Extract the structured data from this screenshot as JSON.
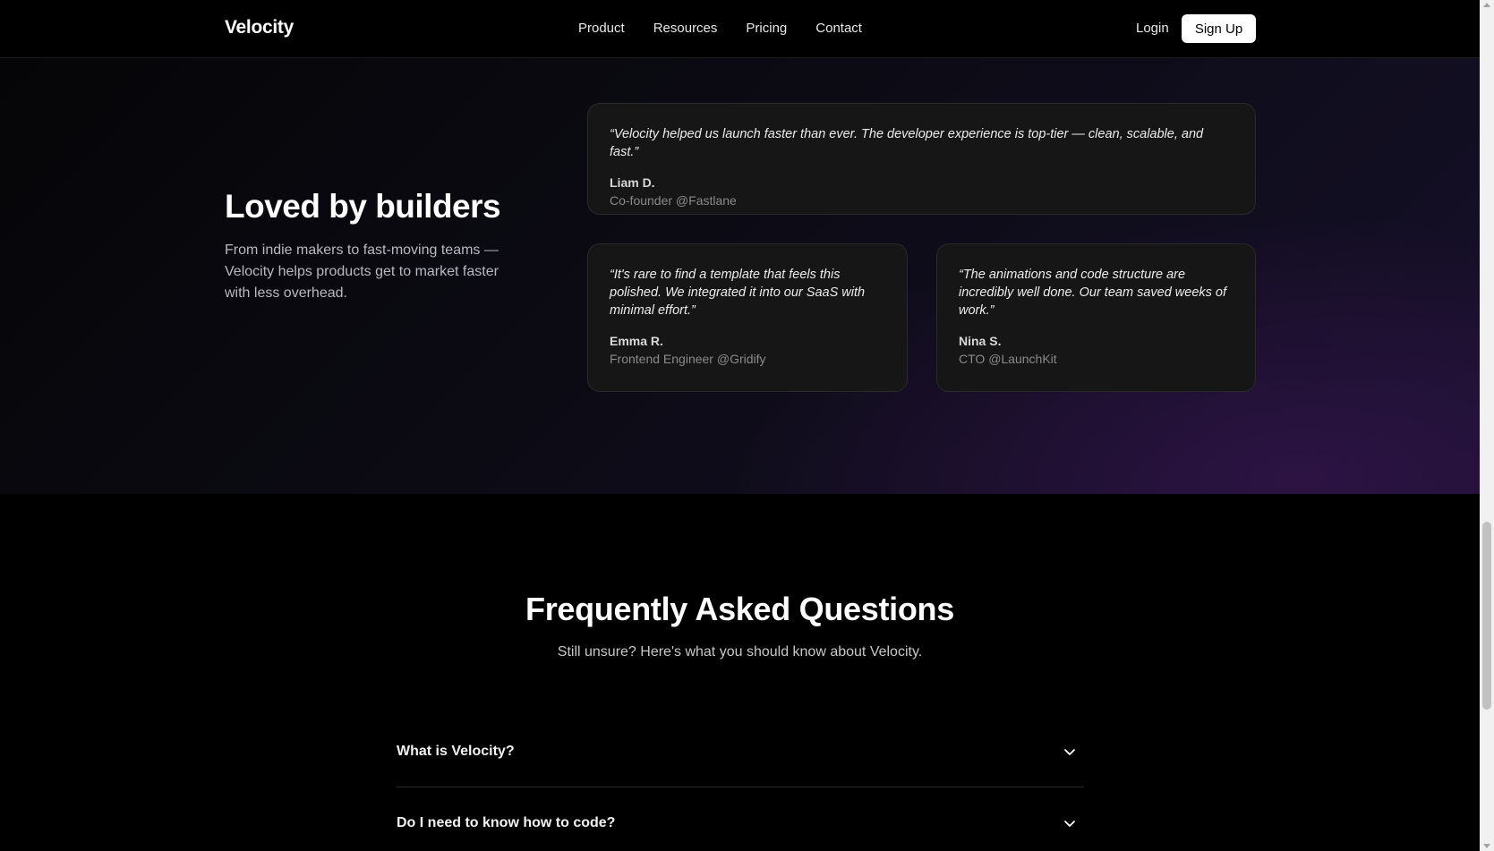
{
  "nav": {
    "logo": "Velocity",
    "links": [
      "Product",
      "Resources",
      "Pricing",
      "Contact"
    ],
    "login_label": "Login",
    "signup_label": "Sign Up"
  },
  "testimonials": {
    "title": "Loved by builders",
    "subtitle": "From indie makers to fast-moving teams — Velocity helps products get to market faster with less overhead.",
    "items": [
      {
        "quote": "“Velocity helped us launch faster than ever. The developer experience is top-tier — clean, scalable, and fast.”",
        "name": "Liam D.",
        "role": "Co-founder @Fastlane"
      },
      {
        "quote": "“It's rare to find a template that feels this polished. We integrated it into our SaaS with minimal effort.”",
        "name": "Emma R.",
        "role": "Frontend Engineer @Gridify"
      },
      {
        "quote": "“The animations and code structure are incredibly well done. Our team saved weeks of work.”",
        "name": "Nina S.",
        "role": "CTO @LaunchKit"
      }
    ]
  },
  "faq": {
    "title": "Frequently Asked Questions",
    "subtitle": "Still unsure? Here's what you should know about Velocity.",
    "questions": [
      "What is Velocity?",
      "Do I need to know how to code?"
    ]
  },
  "icons": {
    "faq_toggle": "chevron-down-icon",
    "scroll_up": "scroll-up-arrow-icon",
    "scroll_down": "scroll-down-arrow-icon"
  },
  "colors": {
    "background": "#000000",
    "card_background": "#161616",
    "accent_glow": "#40165c",
    "signup_button": "#ffffff"
  }
}
